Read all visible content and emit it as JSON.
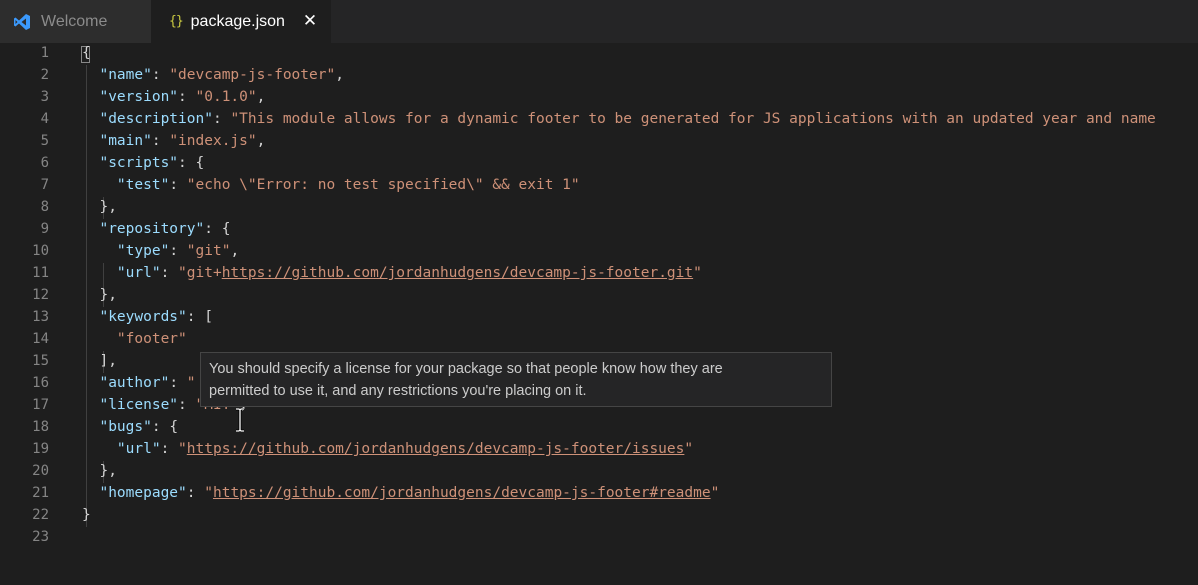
{
  "tabs": [
    {
      "label": "Welcome",
      "icon": "vscode-logo-icon",
      "active": false
    },
    {
      "label": "package.json",
      "icon": "json-braces-icon",
      "icon_glyph": "{}",
      "active": true,
      "close_glyph": "✕"
    }
  ],
  "editor": {
    "line_numbers": [
      "1",
      "2",
      "3",
      "4",
      "5",
      "6",
      "7",
      "8",
      "9",
      "10",
      "11",
      "12",
      "13",
      "14",
      "15",
      "16",
      "17",
      "18",
      "19",
      "20",
      "21",
      "22",
      "23"
    ],
    "lines": [
      [
        {
          "t": "{",
          "c": "p"
        }
      ],
      [
        {
          "t": "  "
        },
        {
          "t": "\"name\"",
          "c": "k"
        },
        {
          "t": ": "
        },
        {
          "t": "\"devcamp-js-footer\"",
          "c": "s"
        },
        {
          "t": ","
        }
      ],
      [
        {
          "t": "  "
        },
        {
          "t": "\"version\"",
          "c": "k"
        },
        {
          "t": ": "
        },
        {
          "t": "\"0.1.0\"",
          "c": "s"
        },
        {
          "t": ","
        }
      ],
      [
        {
          "t": "  "
        },
        {
          "t": "\"description\"",
          "c": "k"
        },
        {
          "t": ": "
        },
        {
          "t": "\"This module allows for a dynamic footer to be generated for JS applications with an updated year and name",
          "c": "s"
        }
      ],
      [
        {
          "t": "  "
        },
        {
          "t": "\"main\"",
          "c": "k"
        },
        {
          "t": ": "
        },
        {
          "t": "\"index.js\"",
          "c": "s"
        },
        {
          "t": ","
        }
      ],
      [
        {
          "t": "  "
        },
        {
          "t": "\"scripts\"",
          "c": "k"
        },
        {
          "t": ": {"
        }
      ],
      [
        {
          "t": "    "
        },
        {
          "t": "\"test\"",
          "c": "k"
        },
        {
          "t": ": "
        },
        {
          "t": "\"echo \\\"Error: no test specified\\\" && exit 1\"",
          "c": "s"
        }
      ],
      [
        {
          "t": "  },"
        }
      ],
      [
        {
          "t": "  "
        },
        {
          "t": "\"repository\"",
          "c": "k"
        },
        {
          "t": ": {"
        }
      ],
      [
        {
          "t": "    "
        },
        {
          "t": "\"type\"",
          "c": "k"
        },
        {
          "t": ": "
        },
        {
          "t": "\"git\"",
          "c": "s"
        },
        {
          "t": ","
        }
      ],
      [
        {
          "t": "    "
        },
        {
          "t": "\"url\"",
          "c": "k"
        },
        {
          "t": ": "
        },
        {
          "t": "\"git+",
          "c": "s"
        },
        {
          "t": "https://github.com/jordanhudgens/devcamp-js-footer.git",
          "c": "s u"
        },
        {
          "t": "\"",
          "c": "s"
        }
      ],
      [
        {
          "t": "  },"
        }
      ],
      [
        {
          "t": "  "
        },
        {
          "t": "\"keywords\"",
          "c": "k"
        },
        {
          "t": ": ["
        }
      ],
      [
        {
          "t": "    "
        },
        {
          "t": "\"footer\"",
          "c": "s"
        }
      ],
      [
        {
          "t": "  ],"
        }
      ],
      [
        {
          "t": "  "
        },
        {
          "t": "\"author\"",
          "c": "k"
        },
        {
          "t": ": "
        },
        {
          "t": "\"",
          "c": "s"
        }
      ],
      [
        {
          "t": "  "
        },
        {
          "t": "\"license\"",
          "c": "k"
        },
        {
          "t": ": "
        },
        {
          "t": "\"MIT\"",
          "c": "s"
        },
        {
          "t": ","
        }
      ],
      [
        {
          "t": "  "
        },
        {
          "t": "\"bugs\"",
          "c": "k"
        },
        {
          "t": ": {"
        }
      ],
      [
        {
          "t": "    "
        },
        {
          "t": "\"url\"",
          "c": "k"
        },
        {
          "t": ": "
        },
        {
          "t": "\"",
          "c": "s"
        },
        {
          "t": "https://github.com/jordanhudgens/devcamp-js-footer/issues",
          "c": "s u"
        },
        {
          "t": "\"",
          "c": "s"
        }
      ],
      [
        {
          "t": "  },"
        }
      ],
      [
        {
          "t": "  "
        },
        {
          "t": "\"homepage\"",
          "c": "k"
        },
        {
          "t": ": "
        },
        {
          "t": "\"",
          "c": "s"
        },
        {
          "t": "https://github.com/jordanhudgens/devcamp-js-footer#readme",
          "c": "s u"
        },
        {
          "t": "\"",
          "c": "s"
        }
      ],
      [
        {
          "t": "}"
        }
      ],
      []
    ]
  },
  "hover": {
    "line1": "You should specify a license for your package so that people know how they are",
    "line2": "permitted to use it, and any restrictions you're placing on it."
  },
  "colors": {
    "background": "#1e1e1e",
    "tabbar": "#252526",
    "key": "#9cdcfe",
    "string": "#ce9178",
    "punctuation": "#d4d4d4",
    "line_number": "#858585",
    "vscode_blue": "#3b99fc"
  }
}
